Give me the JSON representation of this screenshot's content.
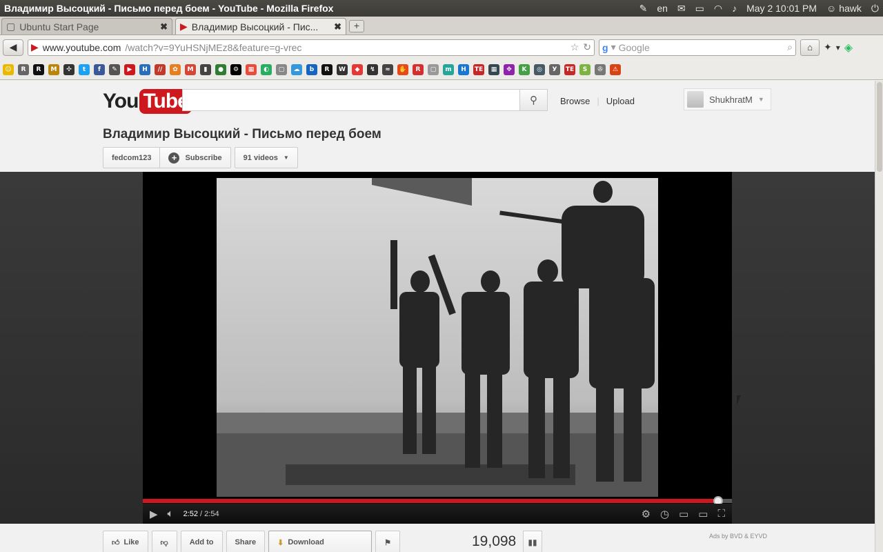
{
  "window": {
    "title": "Владимир Высоцкий - Письмо перед боем - YouTube - Mozilla Firefox",
    "tray": {
      "lang": "en",
      "datetime": "May  2 10:01 PM",
      "user": "hawk"
    }
  },
  "tabs": [
    {
      "label": "Ubuntu Start Page",
      "active": false
    },
    {
      "label": "Владимир Высоцкий - Пис...",
      "active": true
    }
  ],
  "nav": {
    "url_host": "www.youtube.com",
    "url_rest": "/watch?v=9YuHSNjMEz8&feature=g-vrec",
    "search_placeholder": "Google"
  },
  "bookmarks": [
    "☺",
    "R",
    "R",
    "M",
    "✣",
    "t",
    "f",
    "✎",
    "▶",
    "H",
    "//",
    "✿",
    "M",
    "▮",
    "●",
    "⚙",
    "▦",
    "◐",
    "▢",
    "☁",
    "b",
    "R",
    "W",
    "◆",
    "↯",
    "≈",
    "✋",
    "R",
    "▢",
    "m",
    "H",
    "TE",
    "▦",
    "✥",
    "K",
    "◎",
    "У",
    "TE",
    "S",
    "✇",
    "⚠"
  ],
  "youtube": {
    "logo_you": "You",
    "logo_tube": "Tube",
    "search_value": "",
    "browse": "Browse",
    "upload": "Upload",
    "username": "ShukhratM",
    "video_title": "Владимир Высоцкий - Письмо перед боем",
    "channel": "fedcom123",
    "subscribe": "Subscribe",
    "videos_count": "91 videos"
  },
  "player": {
    "current_time": "2:52",
    "total_time": "/ 2:54",
    "progress": 0.977
  },
  "actions": {
    "like": "Like",
    "add_to": "Add to",
    "share": "Share",
    "download": "Download",
    "views": "19,098",
    "ads_note": "Ads by BVD & EYVD"
  }
}
